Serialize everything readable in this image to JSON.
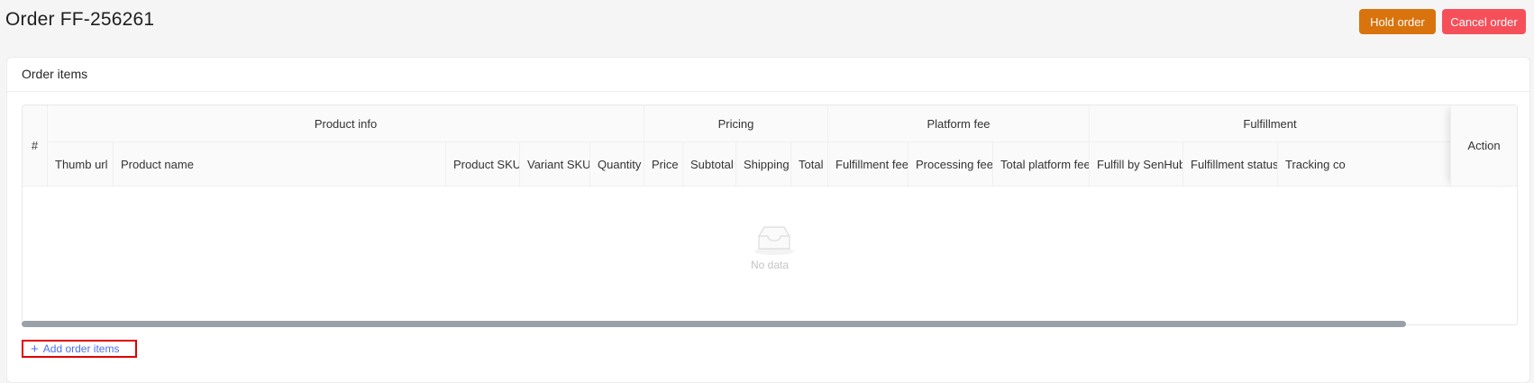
{
  "header": {
    "title": "Order FF-256261",
    "hold_label": "Hold order",
    "cancel_label": "Cancel order"
  },
  "card": {
    "title": "Order items"
  },
  "table": {
    "index_header": "#",
    "groups": [
      "Product info",
      "Pricing",
      "Platform fee",
      "Fulfillment"
    ],
    "columns": [
      "Thumb url",
      "Product name",
      "Product SKU",
      "Variant SKU",
      "Quantity",
      "Price",
      "Subtotal",
      "Shipping",
      "Total",
      "Fulfillment fee",
      "Processing fee",
      "Total platform fee",
      "Fulfill by SenHub",
      "Fulfillment status",
      "Tracking co"
    ],
    "action_header": "Action",
    "empty_text": "No data"
  },
  "add_items_label": "Add order items",
  "colors": {
    "hold_button": "#d9730d",
    "cancel_button": "#f5505a",
    "link": "#4c6ef5",
    "highlight_border": "#e00000"
  },
  "icons": {
    "empty": "empty-inbox-icon",
    "add": "plus-icon"
  }
}
